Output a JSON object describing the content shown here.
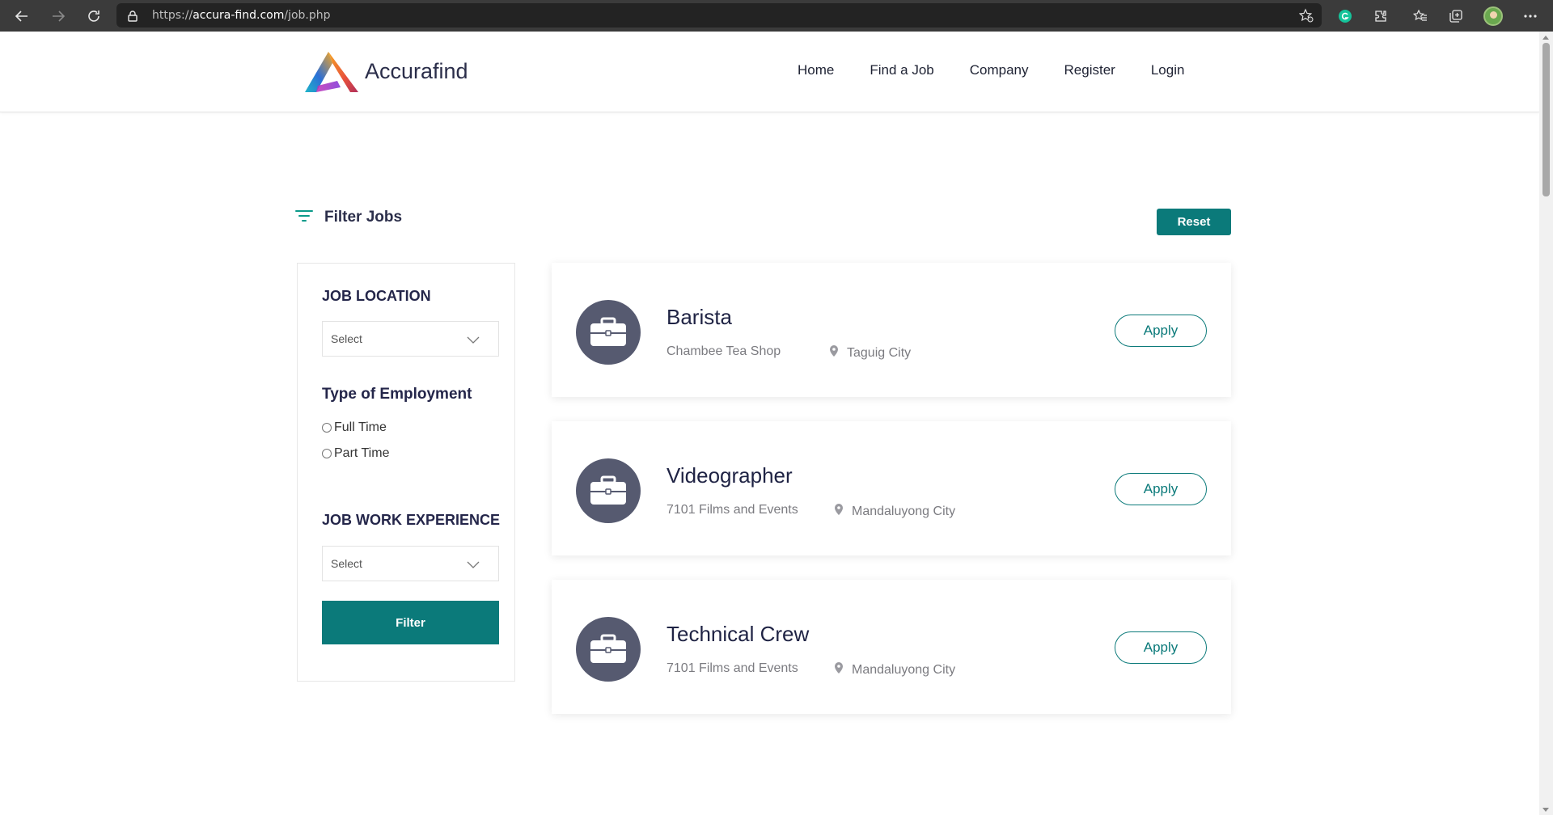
{
  "browser": {
    "url_scheme": "https://",
    "url_host": "accura-find.com",
    "url_path": "/job.php"
  },
  "site": {
    "brand": "Accurafind",
    "nav": [
      "Home",
      "Find a Job",
      "Company",
      "Register",
      "Login"
    ]
  },
  "filter": {
    "title": "Filter Jobs",
    "reset_label": "Reset",
    "location_heading": "JOB LOCATION",
    "location_value": "Select",
    "employment_heading": "Type of Employment",
    "employment_options": [
      "Full Time",
      "Part Time"
    ],
    "experience_heading": "JOB WORK EXPERIENCE",
    "experience_value": "Select",
    "filter_label": "Filter"
  },
  "jobs": [
    {
      "title": "Barista",
      "company": "Chambee Tea Shop",
      "location": "Taguig City",
      "apply": "Apply"
    },
    {
      "title": "Videographer",
      "company": "7101 Films and Events",
      "location": "Mandaluyong City",
      "apply": "Apply"
    },
    {
      "title": "Technical Crew",
      "company": "7101 Films and Events",
      "location": "Mandaluyong City",
      "apply": "Apply"
    }
  ],
  "colors": {
    "accent": "#0b7a7a",
    "job_icon_bg": "#565a70",
    "browser_bar": "#3b3b3b"
  },
  "icons": [
    "back-icon",
    "forward-icon",
    "refresh-icon",
    "lock-icon",
    "favorite-add-icon",
    "grammarly-icon",
    "extensions-icon",
    "favorites-icon",
    "collections-icon",
    "profile-avatar",
    "more-icon",
    "filter-lines-icon",
    "chevron-down-icon",
    "briefcase-icon",
    "map-pin-icon"
  ]
}
